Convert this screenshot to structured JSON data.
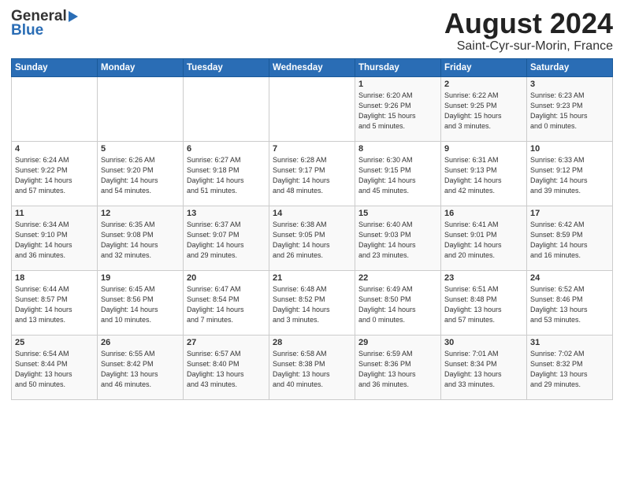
{
  "header": {
    "logo_general": "General",
    "logo_blue": "Blue",
    "month_title": "August 2024",
    "location": "Saint-Cyr-sur-Morin, France"
  },
  "days_of_week": [
    "Sunday",
    "Monday",
    "Tuesday",
    "Wednesday",
    "Thursday",
    "Friday",
    "Saturday"
  ],
  "weeks": [
    [
      {
        "day": "",
        "info": ""
      },
      {
        "day": "",
        "info": ""
      },
      {
        "day": "",
        "info": ""
      },
      {
        "day": "",
        "info": ""
      },
      {
        "day": "1",
        "info": "Sunrise: 6:20 AM\nSunset: 9:26 PM\nDaylight: 15 hours\nand 5 minutes."
      },
      {
        "day": "2",
        "info": "Sunrise: 6:22 AM\nSunset: 9:25 PM\nDaylight: 15 hours\nand 3 minutes."
      },
      {
        "day": "3",
        "info": "Sunrise: 6:23 AM\nSunset: 9:23 PM\nDaylight: 15 hours\nand 0 minutes."
      }
    ],
    [
      {
        "day": "4",
        "info": "Sunrise: 6:24 AM\nSunset: 9:22 PM\nDaylight: 14 hours\nand 57 minutes."
      },
      {
        "day": "5",
        "info": "Sunrise: 6:26 AM\nSunset: 9:20 PM\nDaylight: 14 hours\nand 54 minutes."
      },
      {
        "day": "6",
        "info": "Sunrise: 6:27 AM\nSunset: 9:18 PM\nDaylight: 14 hours\nand 51 minutes."
      },
      {
        "day": "7",
        "info": "Sunrise: 6:28 AM\nSunset: 9:17 PM\nDaylight: 14 hours\nand 48 minutes."
      },
      {
        "day": "8",
        "info": "Sunrise: 6:30 AM\nSunset: 9:15 PM\nDaylight: 14 hours\nand 45 minutes."
      },
      {
        "day": "9",
        "info": "Sunrise: 6:31 AM\nSunset: 9:13 PM\nDaylight: 14 hours\nand 42 minutes."
      },
      {
        "day": "10",
        "info": "Sunrise: 6:33 AM\nSunset: 9:12 PM\nDaylight: 14 hours\nand 39 minutes."
      }
    ],
    [
      {
        "day": "11",
        "info": "Sunrise: 6:34 AM\nSunset: 9:10 PM\nDaylight: 14 hours\nand 36 minutes."
      },
      {
        "day": "12",
        "info": "Sunrise: 6:35 AM\nSunset: 9:08 PM\nDaylight: 14 hours\nand 32 minutes."
      },
      {
        "day": "13",
        "info": "Sunrise: 6:37 AM\nSunset: 9:07 PM\nDaylight: 14 hours\nand 29 minutes."
      },
      {
        "day": "14",
        "info": "Sunrise: 6:38 AM\nSunset: 9:05 PM\nDaylight: 14 hours\nand 26 minutes."
      },
      {
        "day": "15",
        "info": "Sunrise: 6:40 AM\nSunset: 9:03 PM\nDaylight: 14 hours\nand 23 minutes."
      },
      {
        "day": "16",
        "info": "Sunrise: 6:41 AM\nSunset: 9:01 PM\nDaylight: 14 hours\nand 20 minutes."
      },
      {
        "day": "17",
        "info": "Sunrise: 6:42 AM\nSunset: 8:59 PM\nDaylight: 14 hours\nand 16 minutes."
      }
    ],
    [
      {
        "day": "18",
        "info": "Sunrise: 6:44 AM\nSunset: 8:57 PM\nDaylight: 14 hours\nand 13 minutes."
      },
      {
        "day": "19",
        "info": "Sunrise: 6:45 AM\nSunset: 8:56 PM\nDaylight: 14 hours\nand 10 minutes."
      },
      {
        "day": "20",
        "info": "Sunrise: 6:47 AM\nSunset: 8:54 PM\nDaylight: 14 hours\nand 7 minutes."
      },
      {
        "day": "21",
        "info": "Sunrise: 6:48 AM\nSunset: 8:52 PM\nDaylight: 14 hours\nand 3 minutes."
      },
      {
        "day": "22",
        "info": "Sunrise: 6:49 AM\nSunset: 8:50 PM\nDaylight: 14 hours\nand 0 minutes."
      },
      {
        "day": "23",
        "info": "Sunrise: 6:51 AM\nSunset: 8:48 PM\nDaylight: 13 hours\nand 57 minutes."
      },
      {
        "day": "24",
        "info": "Sunrise: 6:52 AM\nSunset: 8:46 PM\nDaylight: 13 hours\nand 53 minutes."
      }
    ],
    [
      {
        "day": "25",
        "info": "Sunrise: 6:54 AM\nSunset: 8:44 PM\nDaylight: 13 hours\nand 50 minutes."
      },
      {
        "day": "26",
        "info": "Sunrise: 6:55 AM\nSunset: 8:42 PM\nDaylight: 13 hours\nand 46 minutes."
      },
      {
        "day": "27",
        "info": "Sunrise: 6:57 AM\nSunset: 8:40 PM\nDaylight: 13 hours\nand 43 minutes."
      },
      {
        "day": "28",
        "info": "Sunrise: 6:58 AM\nSunset: 8:38 PM\nDaylight: 13 hours\nand 40 minutes."
      },
      {
        "day": "29",
        "info": "Sunrise: 6:59 AM\nSunset: 8:36 PM\nDaylight: 13 hours\nand 36 minutes."
      },
      {
        "day": "30",
        "info": "Sunrise: 7:01 AM\nSunset: 8:34 PM\nDaylight: 13 hours\nand 33 minutes."
      },
      {
        "day": "31",
        "info": "Sunrise: 7:02 AM\nSunset: 8:32 PM\nDaylight: 13 hours\nand 29 minutes."
      }
    ]
  ]
}
